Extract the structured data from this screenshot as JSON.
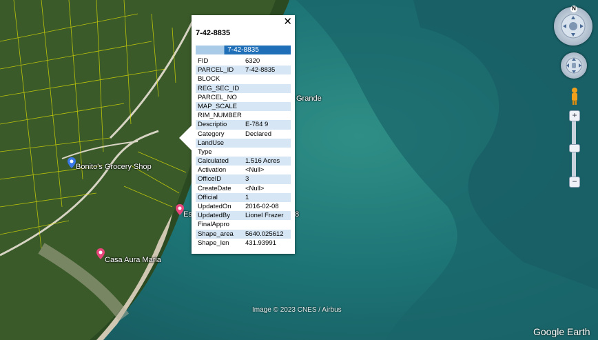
{
  "map": {
    "places": [
      {
        "id": "bonito",
        "label": "Bonito's Grocery Shop"
      },
      {
        "id": "casa",
        "label": "Casa Aura Maria"
      },
      {
        "id": "es",
        "label": "Es"
      },
      {
        "id": "grande",
        "label": "Grande"
      },
      {
        "id": "num8",
        "label": "8"
      }
    ],
    "credit": "Image © 2023 CNES / Airbus",
    "logo": "Google Earth"
  },
  "nav": {
    "compass_letter": "N"
  },
  "popup": {
    "title": "7-42-8835",
    "close": "✕",
    "header": "7-42-8835",
    "rows": [
      {
        "k": "FID",
        "v": "6320"
      },
      {
        "k": "PARCEL_ID",
        "v": "7-42-8835"
      },
      {
        "k": "BLOCK",
        "v": ""
      },
      {
        "k": "REG_SEC_ID",
        "v": ""
      },
      {
        "k": "PARCEL_NO",
        "v": ""
      },
      {
        "k": "MAP_SCALE",
        "v": ""
      },
      {
        "k": "RIM_NUMBER",
        "v": ""
      },
      {
        "k": "Descriptio",
        "v": "E-784 9"
      },
      {
        "k": "Category",
        "v": "Declared"
      },
      {
        "k": "LandUse",
        "v": ""
      },
      {
        "k": "Type",
        "v": ""
      },
      {
        "k": "Calculated",
        "v": "1.516 Acres"
      },
      {
        "k": "Activation",
        "v": "<Null>"
      },
      {
        "k": "OfficeID",
        "v": "3"
      },
      {
        "k": "CreateDate",
        "v": "<Null>"
      },
      {
        "k": "Official",
        "v": "1"
      },
      {
        "k": "UpdatedOn",
        "v": "2016-02-08"
      },
      {
        "k": "UpdatedBy",
        "v": "Lionel Frazer"
      },
      {
        "k": "FinalAppro",
        "v": ""
      },
      {
        "k": "Shape_area",
        "v": "5640.025612"
      },
      {
        "k": "Shape_len",
        "v": "431.93991"
      }
    ]
  }
}
